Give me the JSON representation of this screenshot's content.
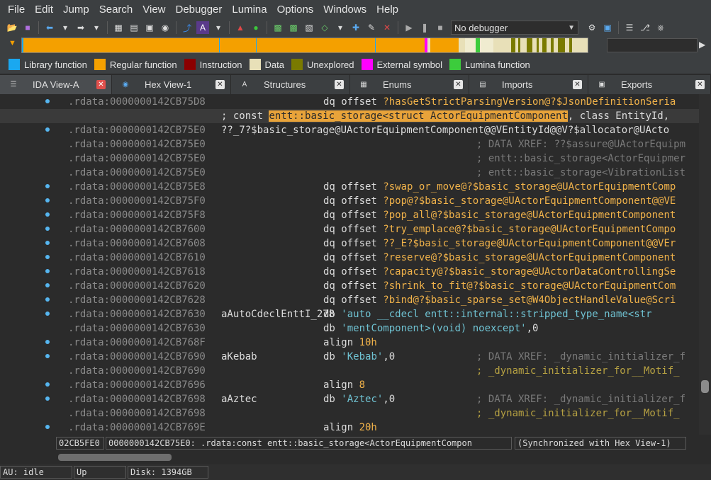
{
  "menu": [
    {
      "label": "File"
    },
    {
      "label": "Edit"
    },
    {
      "label": "Jump"
    },
    {
      "label": "Search"
    },
    {
      "label": "View"
    },
    {
      "label": "Debugger"
    },
    {
      "label": "Lumina"
    },
    {
      "label": "Options"
    },
    {
      "label": "Windows"
    },
    {
      "label": "Help"
    }
  ],
  "toolbar": {
    "debugger_value": "No debugger"
  },
  "legend": [
    {
      "label": "Library function",
      "color": "#1aa8f0"
    },
    {
      "label": "Regular function",
      "color": "#f4a000"
    },
    {
      "label": "Instruction",
      "color": "#8b0000"
    },
    {
      "label": "Data",
      "color": "#e8e0b8"
    },
    {
      "label": "Unexplored",
      "color": "#7a7a00"
    },
    {
      "label": "External symbol",
      "color": "#ff00ff"
    },
    {
      "label": "Lumina function",
      "color": "#3ccc3c"
    }
  ],
  "tabs": [
    {
      "label": "IDA View-A",
      "active": true
    },
    {
      "label": "Hex View-1"
    },
    {
      "label": "Structures"
    },
    {
      "label": "Enums"
    },
    {
      "label": "Imports"
    },
    {
      "label": "Exports"
    }
  ],
  "lines": [
    {
      "addr": ".rdata:0000000142CB75D8",
      "label": "",
      "mnem": "dq offset ",
      "operand": "?hasGetStrictParsingVersion@?$JsonDefinitionSeria",
      "comment": "",
      "dot": true
    },
    {
      "addr": "",
      "label": "; const ",
      "hl": "entt::basic_storage<struct ActorEquipmentComponent",
      "rest": ", class EntityId,",
      "current": true,
      "dot": false
    },
    {
      "addr": ".rdata:0000000142CB75E0",
      "label": "??_7?$basic_storage@UActorEquipmentComponent@@VEntityId@@V?$allocator@UActo",
      "mnem": "",
      "operand": "",
      "comment": "",
      "dot": true
    },
    {
      "addr": ".rdata:0000000142CB75E0",
      "label": "",
      "mnem": "",
      "operand": "",
      "comment": "; DATA XREF: ??$assure@UActorEquipm",
      "dot": false
    },
    {
      "addr": ".rdata:0000000142CB75E0",
      "label": "",
      "mnem": "",
      "operand": "",
      "comment": "; entt::basic_storage<ActorEquipmer",
      "dot": false
    },
    {
      "addr": ".rdata:0000000142CB75E0",
      "label": "",
      "mnem": "",
      "operand": "",
      "comment": "; entt::basic_storage<VibrationList",
      "dot": false
    },
    {
      "addr": ".rdata:0000000142CB75E8",
      "label": "",
      "mnem": "dq offset ",
      "operand": "?swap_or_move@?$basic_storage@UActorEquipmentComp",
      "comment": "",
      "dot": true
    },
    {
      "addr": ".rdata:0000000142CB75F0",
      "label": "",
      "mnem": "dq offset ",
      "operand": "?pop@?$basic_storage@UActorEquipmentComponent@@VE",
      "comment": "",
      "dot": true
    },
    {
      "addr": ".rdata:0000000142CB75F8",
      "label": "",
      "mnem": "dq offset ",
      "operand": "?pop_all@?$basic_storage@UActorEquipmentComponent",
      "comment": "",
      "dot": true
    },
    {
      "addr": ".rdata:0000000142CB7600",
      "label": "",
      "mnem": "dq offset ",
      "operand": "?try_emplace@?$basic_storage@UActorEquipmentCompo",
      "comment": "",
      "dot": true
    },
    {
      "addr": ".rdata:0000000142CB7608",
      "label": "",
      "mnem": "dq offset ",
      "operand": "??_E?$basic_storage@UActorEquipmentComponent@@VEr",
      "comment": "",
      "dot": true
    },
    {
      "addr": ".rdata:0000000142CB7610",
      "label": "",
      "mnem": "dq offset ",
      "operand": "?reserve@?$basic_storage@UActorEquipmentComponent",
      "comment": "",
      "dot": true
    },
    {
      "addr": ".rdata:0000000142CB7618",
      "label": "",
      "mnem": "dq offset ",
      "operand": "?capacity@?$basic_storage@UActorDataControllingSe",
      "comment": "",
      "dot": true
    },
    {
      "addr": ".rdata:0000000142CB7620",
      "label": "",
      "mnem": "dq offset ",
      "operand": "?shrink_to_fit@?$basic_storage@UActorEquipmentCom",
      "comment": "",
      "dot": true
    },
    {
      "addr": ".rdata:0000000142CB7628",
      "label": "",
      "mnem": "dq offset ",
      "operand": "?bind@?$basic_sparse_set@W4ObjectHandleValue@Scri",
      "comment": "",
      "dot": true
    },
    {
      "addr": ".rdata:0000000142CB7630",
      "label": "aAutoCdeclEnttI_278",
      "mnem": "db ",
      "str": "'auto __cdecl entt::internal::stripped_type_name<str",
      "comment": "",
      "dot": true,
      "labelInline": true
    },
    {
      "addr": ".rdata:0000000142CB7630",
      "label": "",
      "mnem": "db ",
      "str": "'mentComponent>(void) noexcept'",
      "tail": ",0",
      "comment": "",
      "dot": false
    },
    {
      "addr": ".rdata:0000000142CB768F",
      "label": "",
      "mnem": "align ",
      "num": "10h",
      "comment": "",
      "dot": true
    },
    {
      "addr": ".rdata:0000000142CB7690",
      "label": "aKebab",
      "mnem": "db ",
      "str": "'Kebab'",
      "tail": ",0",
      "comment": "; DATA XREF: _dynamic_initializer_f",
      "dot": true
    },
    {
      "addr": ".rdata:0000000142CB7690",
      "label": "",
      "mnem": "",
      "operand": "",
      "comment": "; _dynamic_initializer_for__Motif_",
      "commentYellow": true,
      "dot": false
    },
    {
      "addr": ".rdata:0000000142CB7696",
      "label": "",
      "mnem": "align ",
      "num": "8",
      "comment": "",
      "dot": true
    },
    {
      "addr": ".rdata:0000000142CB7698",
      "label": "aAztec",
      "mnem": "db ",
      "str": "'Aztec'",
      "tail": ",0",
      "comment": "; DATA XREF: _dynamic_initializer_f",
      "dot": true
    },
    {
      "addr": ".rdata:0000000142CB7698",
      "label": "",
      "mnem": "",
      "operand": "",
      "comment": "; _dynamic_initializer_for__Motif_",
      "commentYellow": true,
      "dot": false
    },
    {
      "addr": ".rdata:0000000142CB769E",
      "label": "",
      "mnem": "align ",
      "num": "20h",
      "comment": "",
      "dot": true
    }
  ],
  "status": {
    "offset": "02CB5FE0",
    "location": "0000000142CB75E0: .rdata:const entt::basic_storage<ActorEquipmentCompon",
    "sync": "(Synchronized with Hex View-1)"
  },
  "bottom": {
    "au": "AU:  idle",
    "dir": "Up",
    "disk": "Disk: 1394GB"
  }
}
